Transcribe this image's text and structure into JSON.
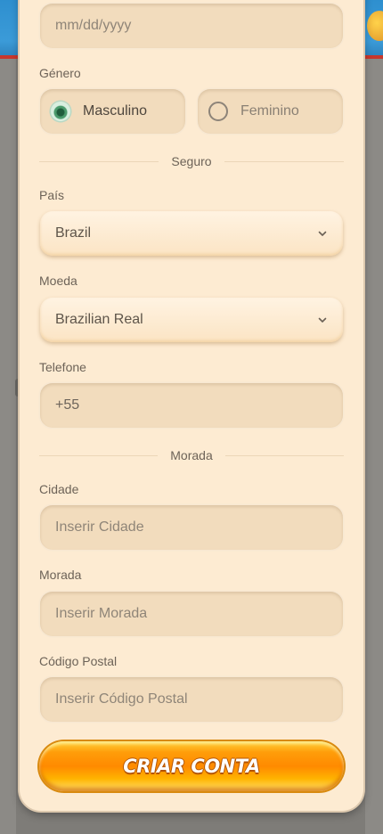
{
  "birthdate": {
    "placeholder": "mm/dd/yyyy"
  },
  "gender": {
    "label": "Género",
    "options": [
      {
        "label": "Masculino",
        "selected": true
      },
      {
        "label": "Feminino",
        "selected": false
      }
    ]
  },
  "sections": {
    "security": "Seguro",
    "address": "Morada"
  },
  "country": {
    "label": "País",
    "value": "Brazil"
  },
  "currency": {
    "label": "Moeda",
    "value": "Brazilian Real"
  },
  "phone": {
    "label": "Telefone",
    "value": "+55"
  },
  "city": {
    "label": "Cidade",
    "placeholder": "Inserir Cidade"
  },
  "street": {
    "label": "Morada",
    "placeholder": "Inserir Morada"
  },
  "postal": {
    "label": "Código Postal",
    "placeholder": "Inserir Código Postal"
  },
  "submit": {
    "label": "CRIAR CONTA"
  },
  "colors": {
    "accent": "#ff9d0a",
    "panel": "#fdebd2",
    "field": "#f2dcbd"
  },
  "icons": {
    "select_arrow": "chevron-down-icon",
    "gender_selected": "radio-checked-icon"
  }
}
